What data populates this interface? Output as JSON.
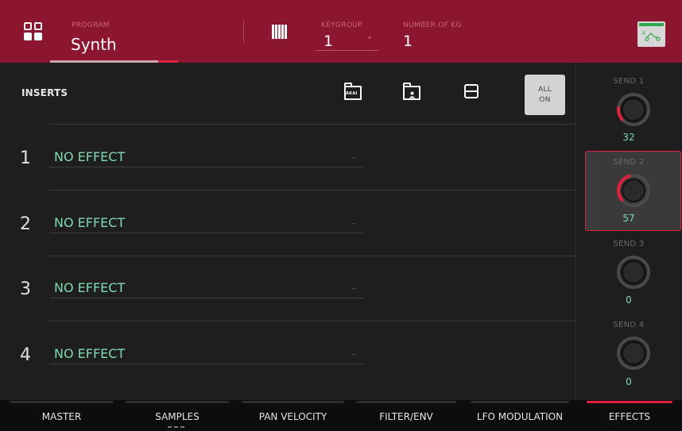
{
  "header": {
    "program_label": "PROGRAM",
    "program_value": "Synth",
    "keygroup_label": "KEYGROUP",
    "keygroup_value": "1",
    "num_kg_label": "NUMBER OF KG",
    "num_kg_value": "1"
  },
  "inserts": {
    "title": "INSERTS",
    "all_on_line1": "ALL",
    "all_on_line2": "ON",
    "akai_text": "AKAI",
    "slots": [
      {
        "number": "1",
        "effect": "NO EFFECT"
      },
      {
        "number": "2",
        "effect": "NO EFFECT"
      },
      {
        "number": "3",
        "effect": "NO EFFECT"
      },
      {
        "number": "4",
        "effect": "NO EFFECT"
      }
    ]
  },
  "sends": [
    {
      "label": "SEND 1",
      "value": "32"
    },
    {
      "label": "SEND 2",
      "value": "57"
    },
    {
      "label": "SEND 3",
      "value": "0"
    },
    {
      "label": "SEND 4",
      "value": "0"
    }
  ],
  "tabs": [
    {
      "label": "MASTER"
    },
    {
      "label": "SAMPLES"
    },
    {
      "label": "PAN VELOCITY"
    },
    {
      "label": "FILTER/ENV"
    },
    {
      "label": "LFO MODULATION"
    },
    {
      "label": "EFFECTS"
    }
  ],
  "route_icon_text": "R",
  "colors": {
    "header_bg": "#8c1630",
    "accent_red": "#e0213f",
    "value_green": "#7fd9b2",
    "route_green": "#2fa84b"
  }
}
